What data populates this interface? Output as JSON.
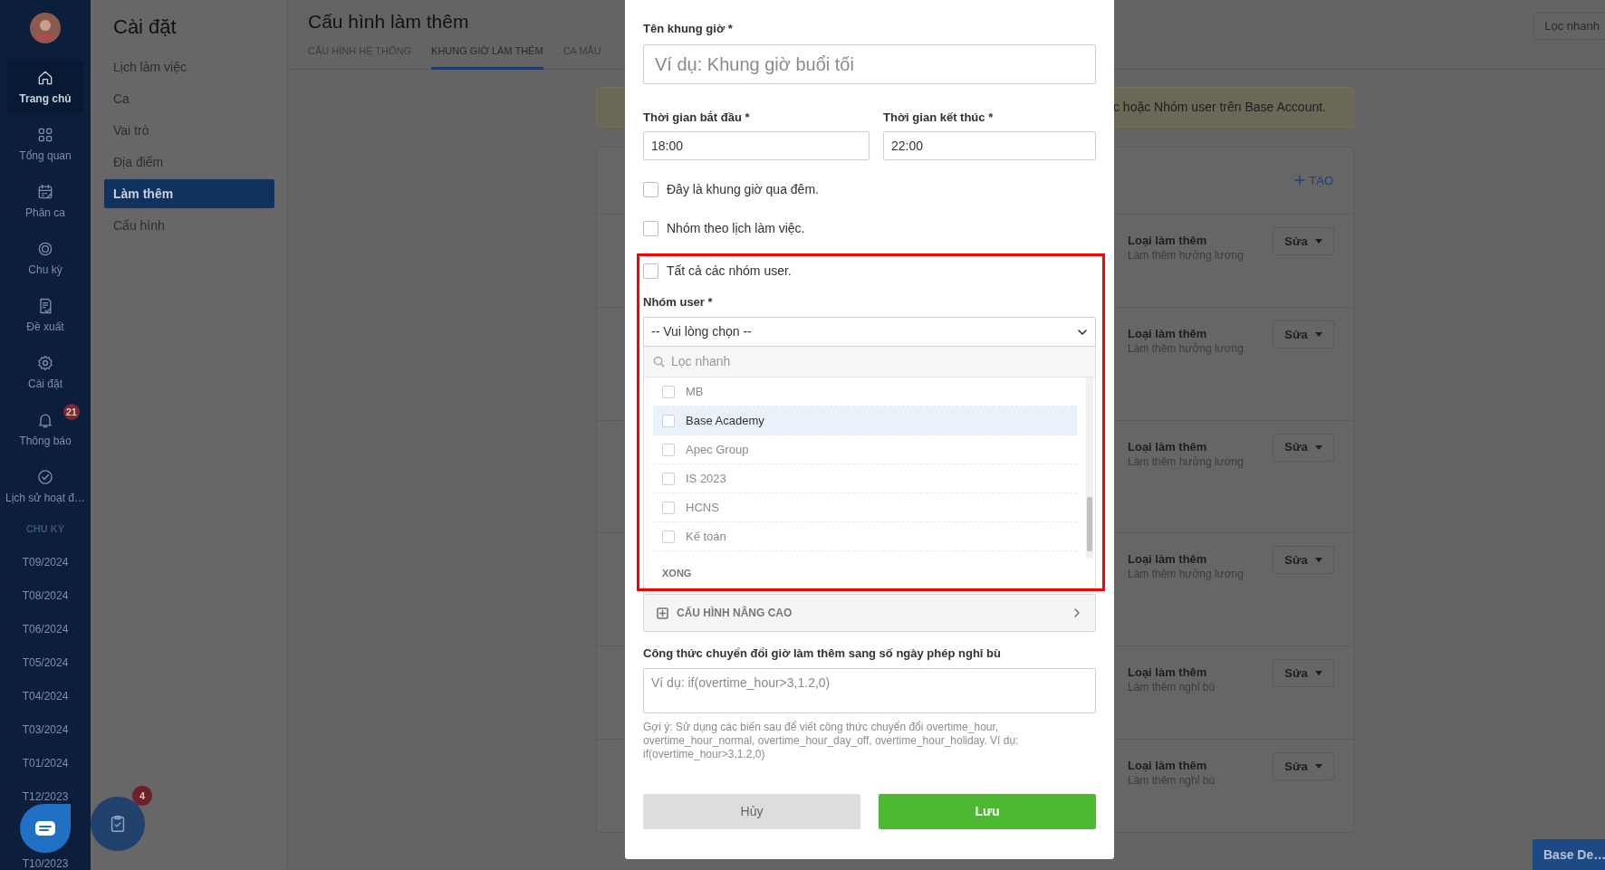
{
  "sidebar": {
    "nav": [
      {
        "label": "Trang chủ",
        "selected": true
      },
      {
        "label": "Tổng quan",
        "selected": false
      },
      {
        "label": "Phân ca",
        "selected": false
      },
      {
        "label": "Chu kỳ",
        "selected": false
      },
      {
        "label": "Đề xuất",
        "selected": false
      },
      {
        "label": "Cài đặt",
        "selected": false
      },
      {
        "label": "Thông báo",
        "selected": false,
        "badge": "21"
      },
      {
        "label": "Lịch sử hoạt đ…",
        "selected": false
      }
    ],
    "section_title": "CHU KỲ",
    "periods": [
      "T09/2024",
      "T08/2024",
      "T06/2024",
      "T05/2024",
      "T04/2024",
      "T03/2024",
      "T01/2024",
      "T12/2023",
      "T10/2023"
    ]
  },
  "settings_menu": {
    "title": "Cài đặt",
    "items": [
      {
        "label": "Lịch làm việc",
        "selected": false
      },
      {
        "label": "Ca",
        "selected": false
      },
      {
        "label": "Vai trò",
        "selected": false
      },
      {
        "label": "Địa điểm",
        "selected": false
      },
      {
        "label": "Làm thêm",
        "selected": true
      },
      {
        "label": "Cấu hình",
        "selected": false
      }
    ]
  },
  "header": {
    "title": "Cấu hình làm thêm",
    "tabs": [
      {
        "label": "CẤU HÌNH HỆ THỐNG",
        "selected": false
      },
      {
        "label": "KHUNG GIỜ LÀM THÊM",
        "selected": true
      },
      {
        "label": "CA MẪU",
        "selected": false
      }
    ]
  },
  "quick_filter": "Lọc nhanh",
  "alert": "c hoặc Nhóm user trên Base Account.",
  "card": {
    "create": "TẠO",
    "rows": [
      {
        "title": "Loại làm thêm",
        "subtitle": "Làm thêm hưởng lương",
        "action": "Sửa"
      },
      {
        "title": "Loại làm thêm",
        "subtitle": "Làm thêm hưởng lương",
        "action": "Sửa"
      },
      {
        "title": "Loại làm thêm",
        "subtitle": "Làm thêm hưởng lương",
        "action": "Sửa"
      },
      {
        "title": "Loại làm thêm",
        "subtitle": "Làm thêm hưởng lương",
        "action": "Sửa"
      },
      {
        "title": "Loại làm thêm",
        "subtitle": "Làm thêm nghỉ bù",
        "action": "Sửa"
      },
      {
        "title": "Loại làm thêm",
        "subtitle": "Làm thêm nghỉ bù",
        "action": "Sửa"
      }
    ]
  },
  "modal": {
    "name_field": {
      "label": "Tên khung giờ *",
      "placeholder": "Ví dụ: Khung giờ buổi tối"
    },
    "start_field": {
      "label": "Thời gian bắt đầu *",
      "value": "18:00"
    },
    "end_field": {
      "label": "Thời gian kết thúc *",
      "value": "22:00"
    },
    "options": [
      {
        "label": "Đây là khung giờ qua đêm.",
        "checked": false
      },
      {
        "label": "Nhóm theo lịch làm việc.",
        "checked": false
      },
      {
        "label": "Tất cả các nhóm user.",
        "checked": false
      }
    ],
    "group_select": {
      "label": "Nhóm user *",
      "value": "-- Vui lòng chọn --",
      "search_placeholder": "Lọc nhanh",
      "done": "XONG",
      "items": [
        {
          "label": "MB",
          "checked": false,
          "selected": false
        },
        {
          "label": "Base Academy",
          "checked": false,
          "selected": true
        },
        {
          "label": "Apec Group",
          "checked": false,
          "selected": false
        },
        {
          "label": "IS 2023",
          "checked": false,
          "selected": false
        },
        {
          "label": "HCNS",
          "checked": false,
          "selected": false
        },
        {
          "label": "Kế toán",
          "checked": false,
          "selected": false
        }
      ]
    },
    "advanced": "CẤU HÌNH NÂNG CAO",
    "formula": {
      "label": "Công thức chuyển đổi giờ làm thêm sang số ngày phép nghỉ bù",
      "placeholder": "Ví dụ: if(overtime_hour>3,1.2,0)",
      "hint": "Gợi ý: Sử dụng các biến sau để viết công thức chuyển đổi overtime_hour, overtime_hour_normal, overtime_hour_day_off, overtime_hour_holiday. Ví dụ: if(overtime_hour>3,1.2,0)"
    },
    "cancel": "Hủy",
    "save": "Lưu"
  },
  "tasks_badge": "4",
  "corner_button": "Base De…"
}
